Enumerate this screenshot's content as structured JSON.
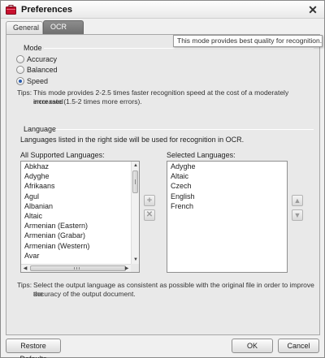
{
  "window": {
    "title": "Preferences",
    "close_symbol": "✕",
    "app_icon": "briefcase-icon",
    "accent_color": "#c8102e"
  },
  "tabs": [
    {
      "label": "General",
      "active": false
    },
    {
      "label": "OCR",
      "active": true
    }
  ],
  "mode": {
    "title": "Mode",
    "options": [
      {
        "label": "Accuracy",
        "checked": false
      },
      {
        "label": "Balanced",
        "checked": false
      },
      {
        "label": "Speed",
        "checked": true
      }
    ],
    "tooltip": "This mode provides best quality for recognition.",
    "tips_label": "Tips:",
    "tips_line1": "This mode provides 2-2.5 times faster recognition speed at the cost of a moderately increased",
    "tips_line2": "error rate (1.5-2 times more errors)."
  },
  "language": {
    "title": "Language",
    "description": "Languages listed in the right side will be used for recognition in OCR.",
    "all_label": "All Supported Languages:",
    "selected_label": "Selected Languages:",
    "all_languages": [
      "Abkhaz",
      "Adyghe",
      "Afrikaans",
      "Agul",
      "Albanian",
      "Altaic",
      "Armenian (Eastern)",
      "Armenian (Grabar)",
      "Armenian (Western)",
      "Avar"
    ],
    "selected_languages": [
      "Adyghe",
      "Altaic",
      "Czech",
      "English",
      "French"
    ],
    "tips_label": "Tips:",
    "tips_line1": "Select the output language as consistent as possible with the original file in order to improve the",
    "tips_line2": "accuracy of the output document."
  },
  "footer": {
    "restore_label": "Restore Defaults",
    "ok_label": "OK",
    "cancel_label": "Cancel"
  }
}
